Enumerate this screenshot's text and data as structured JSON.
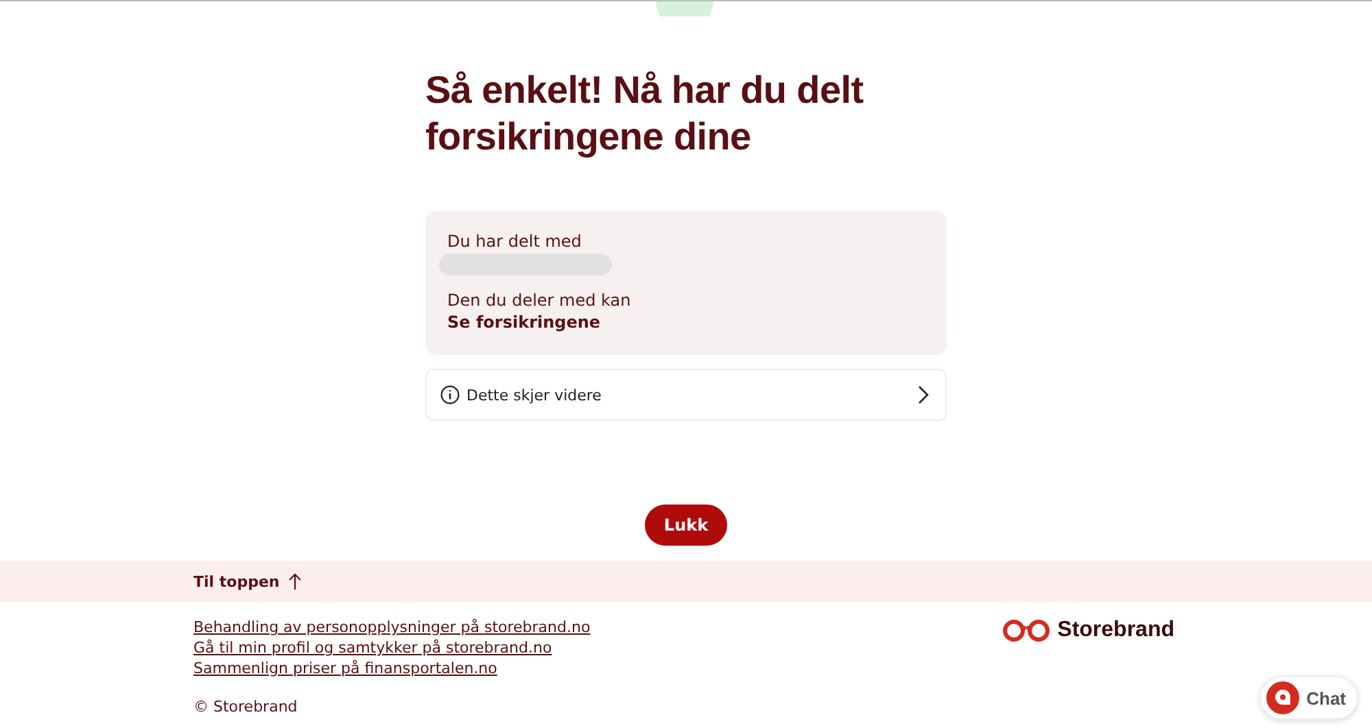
{
  "heading": "Så enkelt! Nå har du delt forsikringene dine",
  "summary": {
    "shared_with_label": "Du har delt med",
    "access_label": "Den du deler med kan",
    "access_value": "Se forsikringene"
  },
  "info_row": {
    "label": "Dette skjer videre",
    "expanded": false
  },
  "close_button": "Lukk",
  "footer": {
    "to_top": "Til toppen",
    "links": [
      "Behandling av personopplysninger på storebrand.no",
      "Gå til min profil og samtykker på storebrand.no",
      "Sammenlign priser på finansportalen.no"
    ],
    "copyright": "© Storebrand",
    "brand": "Storebrand"
  },
  "chat_button": "Chat"
}
